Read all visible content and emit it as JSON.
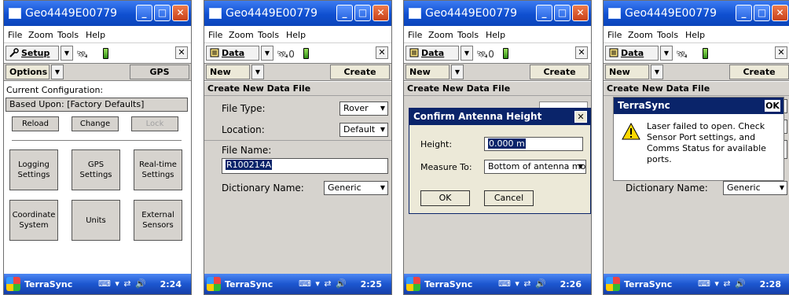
{
  "screens": [
    {
      "title": "Geo4449E00779",
      "menu": [
        "File",
        "Zoom",
        "Tools",
        "Help"
      ],
      "section": "Setup",
      "sat_count": "",
      "sub_left": "Options",
      "sub_right": "GPS",
      "current_configuration_label": "Current Configuration:",
      "based_upon": "Based Upon: [Factory Defaults]",
      "buttons_row": [
        "Reload",
        "Change",
        "Lock"
      ],
      "grid_buttons": [
        [
          "Logging Settings",
          "GPS Settings",
          "Real-time Settings"
        ],
        [
          "Coordinate System",
          "Units",
          "External Sensors"
        ]
      ],
      "taskbar_app": "TerraSync",
      "time": "2:24"
    },
    {
      "title": "Geo4449E00779",
      "menu": [
        "File",
        "Zoom",
        "Tools",
        "Help"
      ],
      "section": "Data",
      "sat_count": "0",
      "sub_left": "New",
      "sub_right": "Create",
      "section_header": "Create New Data File",
      "file_type_label": "File Type:",
      "file_type_value": "Rover",
      "location_label": "Location:",
      "location_value": "Default",
      "file_name_label": "File Name:",
      "file_name_value": "R100214A",
      "dictionary_label": "Dictionary Name:",
      "dictionary_value": "Generic",
      "taskbar_app": "TerraSync",
      "time": "2:25"
    },
    {
      "title": "Geo4449E00779",
      "menu": [
        "File",
        "Zoom",
        "Tools",
        "Help"
      ],
      "section": "Data",
      "sat_count": "0",
      "sub_left": "New",
      "sub_right": "Create",
      "section_header": "Create New Data File",
      "dialog": {
        "title": "Confirm Antenna Height",
        "height_label": "Height:",
        "height_value": "0.000 m",
        "measure_label": "Measure To:",
        "measure_value": "Bottom of antenna mo",
        "ok": "OK",
        "cancel": "Cancel"
      },
      "taskbar_app": "TerraSync",
      "time": "2:26"
    },
    {
      "title": "Geo4449E00779",
      "menu": [
        "File",
        "Zoom",
        "Tools",
        "Help"
      ],
      "section": "Data",
      "sat_count": "",
      "sub_left": "New",
      "sub_right": "Create",
      "section_header": "Create New Data File",
      "dictionary_label": "Dictionary Name:",
      "dictionary_value": "Generic",
      "alert": {
        "title": "TerraSync",
        "ok": "OK",
        "message": "Laser failed to open. Check Sensor Port settings, and Comms Status for available ports."
      },
      "taskbar_app": "TerraSync",
      "time": "2:28"
    }
  ],
  "colors": {
    "title_blue": "#0f4fd0",
    "taskbar_blue": "#1c56cf",
    "dialog_title": "#0a246a",
    "panel_beige": "#d6d3ce",
    "close_red": "#c8411a"
  }
}
